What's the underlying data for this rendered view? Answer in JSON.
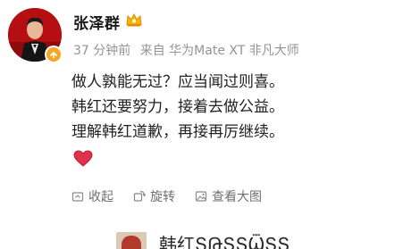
{
  "user": {
    "name": "张泽群",
    "badge_icon": "crown-icon",
    "verified_icon": "verified-badge-icon"
  },
  "meta": {
    "time": "37 分钟前",
    "source": "来自 华为Mate XT 非凡大师"
  },
  "post": {
    "lines": [
      "做人孰能无过？应当闻过则喜。",
      "韩红还要努力，接着去做公益。",
      "理解韩红道歉，再接再厉继续。"
    ],
    "emoji": "heart-icon"
  },
  "actions": [
    {
      "label": "收起",
      "icon": "collapse-icon"
    },
    {
      "label": "旋转",
      "icon": "rotate-icon"
    },
    {
      "label": "查看大图",
      "icon": "view-image-icon"
    }
  ],
  "preview": {
    "text": "韩红ՏԹՏՏѾՏՏ"
  },
  "colors": {
    "accent_verified": "#f5a623",
    "meta_text": "#939393",
    "heart": "#e0314b"
  }
}
